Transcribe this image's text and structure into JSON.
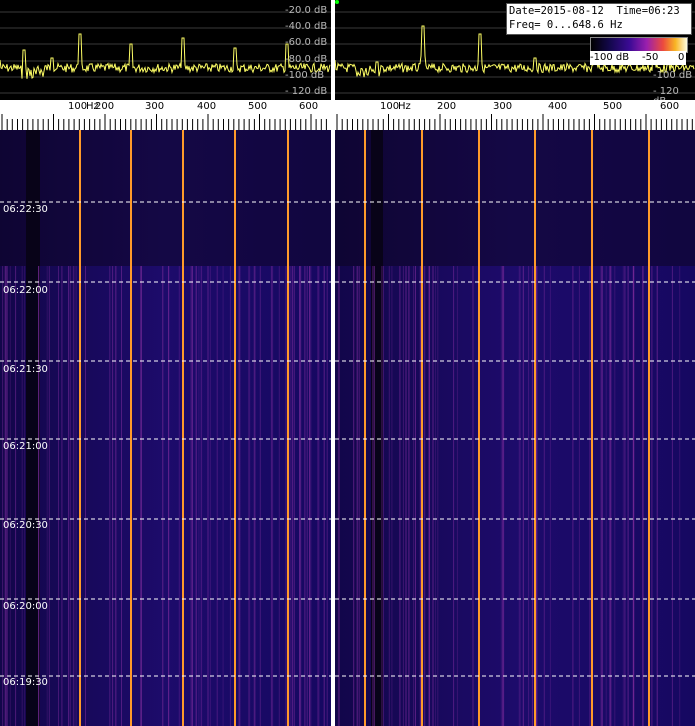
{
  "info": {
    "date_time": "Date=2015-08-12  Time=06:23",
    "freq_range": "Freq= 0...648.6 Hz"
  },
  "spectrum_db_labels": [
    "-20.0 dB",
    "-40.0 dB",
    "-60.0 dB",
    "-80.0 dB",
    "-100 dB",
    "- 120 dB"
  ],
  "right_db_labels": [
    "-100 dB",
    "- 120 dB"
  ],
  "freq_ticks": [
    "100",
    "Hz",
    "200",
    "300",
    "400",
    "500",
    "600"
  ],
  "colorbar": {
    "labels": [
      "-100 dB",
      "-50",
      "0"
    ]
  },
  "time_labels": [
    "06:22:30",
    "06:22:00",
    "06:21:30",
    "06:21:00",
    "06:20:30",
    "06:20:00",
    "06:19:30"
  ],
  "colors": {
    "background": "#000000",
    "trace": "#ffff66",
    "waterfall_base": "#1a0a66",
    "line_orange": "#ff9a2a",
    "line_magenta": "#a02a8a"
  }
}
